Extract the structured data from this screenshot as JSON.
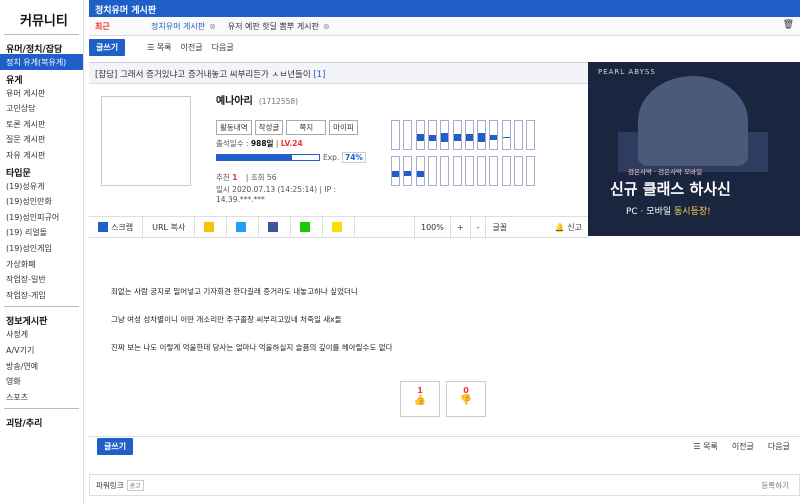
{
  "sidebar": {
    "title": "커뮤니티",
    "sections": [
      {
        "head": "유머/정치/잡담",
        "items": [
          {
            "label": "정치 유게(복유게)",
            "active": true
          }
        ]
      },
      {
        "head": "유게",
        "items": [
          {
            "label": "유머 게시판"
          },
          {
            "label": "고민상담"
          },
          {
            "label": "토론 게시판"
          },
          {
            "label": "질문 게시판"
          },
          {
            "label": "자유 게시판"
          }
        ]
      },
      {
        "head": "타입문",
        "items": [
          {
            "label": "(19)성유게"
          },
          {
            "label": "(19)성인만화"
          },
          {
            "label": "(19)성인피규어"
          },
          {
            "label": "(19) 리얼돌"
          },
          {
            "label": "(19)성인게임"
          },
          {
            "label": "가상화폐"
          },
          {
            "label": "작업장-일반"
          },
          {
            "label": "작업장-게임"
          }
        ]
      },
      {
        "head": "정보게시판",
        "items": [
          {
            "label": "사정게"
          },
          {
            "label": "A/V기기"
          },
          {
            "label": "방송/연예"
          },
          {
            "label": "영화"
          },
          {
            "label": "스포츠"
          }
        ]
      },
      {
        "head": "괴담/추리",
        "items": []
      }
    ]
  },
  "board": {
    "title": "정치유머 게시판",
    "recent_label": "최근",
    "recent": [
      {
        "label": "정치유머 게시판",
        "close": "⊗"
      },
      {
        "label": "유저 예판 핫딜 뽐뿌 게시판",
        "close": "⊗"
      }
    ],
    "trash": "🗑"
  },
  "toolbar": {
    "write": "글쓰기",
    "list": "목록",
    "prev": "이전글",
    "next": "다음글"
  },
  "post": {
    "category": "[잡담]",
    "title": "그래서 증거있냐고 증거내놓고 씨부리든가 ㅅㅂ년들이",
    "comments": "[1]",
    "body": [
      "죄없는 사람 궁지로 밀어넣고 기자회견 한다길래 증거라도 내놓고하나 싶었더니",
      "그냥 여성 성차별이니 이딴 개소리만 주구졸창 씨부리고있네 처죽일 새x들",
      "진짜 보는 나도 이렇게 억울한데 당사는 얼마나 억울하실지 슬픔의 깊이를 헤아릴수도 없다"
    ],
    "upvotes": "1",
    "downvotes": "0"
  },
  "author": {
    "nick": "예나아리",
    "uid": "(1712558)",
    "buttons": [
      "활동내역",
      "작성글",
      "쪽지",
      "마이피"
    ],
    "attendance_label": "출석일수 :",
    "attendance": "988일",
    "level": "LV.24",
    "exp_label": "Exp.",
    "exp_percent": "74%",
    "exp_value": 74,
    "recommend_label": "추천",
    "recommend": "1",
    "views": "조회 56",
    "date": "일시 2020.07.13 (14:25:14)",
    "ip_label": "IP :",
    "ip": "14.39.***.***"
  },
  "activity_graph": {
    "top_row": [
      0,
      0,
      0.25,
      0.2,
      0.3,
      0.25,
      0.25,
      0.3,
      0.15,
      0.05,
      0,
      0
    ],
    "bottom_row": [
      0.2,
      0.15,
      0.2,
      0,
      0,
      0,
      0,
      0,
      0,
      0,
      0,
      0
    ],
    "color": "#1f5fc7"
  },
  "share": {
    "scrap": "스크랩",
    "url_copy": "URL 복사",
    "zoom": "100%",
    "plus": "+",
    "minus": "-",
    "font": "글꼴",
    "report": "신고",
    "icons": [
      {
        "name": "kakaostory-icon",
        "color": "#f5c400"
      },
      {
        "name": "twitter-icon",
        "color": "#1da1f2"
      },
      {
        "name": "facebook-icon",
        "color": "#3b5998"
      },
      {
        "name": "naver-icon",
        "color": "#1ec800"
      },
      {
        "name": "kakaotalk-icon",
        "color": "#f9e000"
      }
    ]
  },
  "ad": {
    "brand": "PEARL ABYSS",
    "subtitle": "검은사막 · 검은사막 모바일",
    "headline": "신규 클래스 하사신",
    "footer_left": "PC · 모바일",
    "footer_right": "동시등장!"
  },
  "footer": {
    "powerlink": "파워링크",
    "powerlink_tag": "광고",
    "register": "등록하기"
  },
  "colors": {
    "accent": "#1f5fc7",
    "highlight": "#e33333"
  }
}
